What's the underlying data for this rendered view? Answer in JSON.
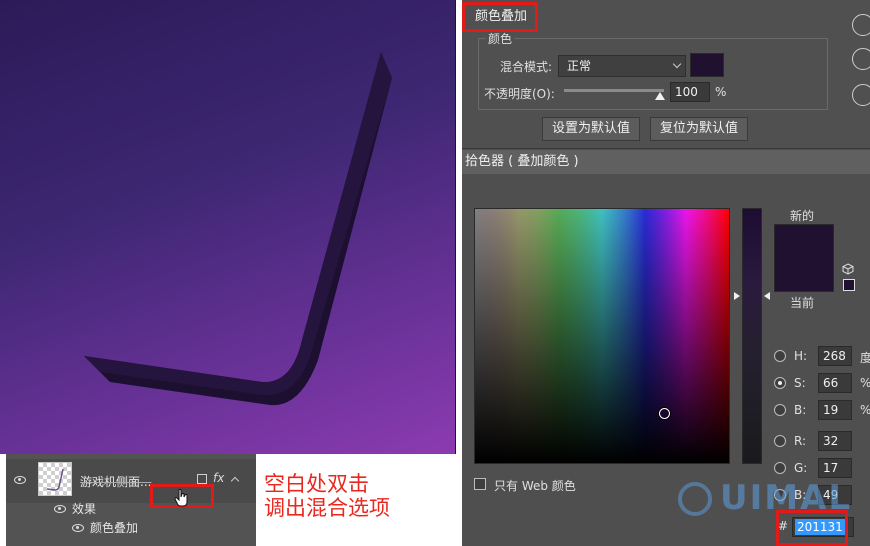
{
  "layers": {
    "layer_name": "游戏机侧面...",
    "effects_label": "效果",
    "effect_item": "颜色叠加",
    "fx_label": "fx"
  },
  "annotation": {
    "line1": "空白处双击",
    "line2": "调出混合选项"
  },
  "layer_style": {
    "title": "颜色叠加",
    "group_label": "颜色",
    "blend_mode_label": "混合模式:",
    "blend_mode_value": "正常",
    "opacity_label": "不透明度(O):",
    "opacity_value": "100",
    "opacity_unit": "%",
    "opacity_level": 1.0,
    "overlay_color": "#201131",
    "set_default_label": "设置为默认值",
    "reset_default_label": "复位为默认值"
  },
  "color_picker": {
    "title": "拾色器 ( 叠加颜色 )",
    "new_label": "新的",
    "current_label": "当前",
    "new_color": "#201131",
    "current_color": "#201131",
    "web_only_label": "只有 Web 颜色",
    "fields": [
      {
        "key": "H:",
        "value": "268",
        "unit": "度",
        "selected": false
      },
      {
        "key": "S:",
        "value": "66",
        "unit": "%",
        "selected": true
      },
      {
        "key": "B:",
        "value": "19",
        "unit": "%",
        "selected": false
      },
      {
        "key": "R:",
        "value": "32",
        "unit": "",
        "selected": false
      },
      {
        "key": "G:",
        "value": "17",
        "unit": "",
        "selected": false
      },
      {
        "key": "B:",
        "value": "49",
        "unit": "",
        "selected": false
      }
    ],
    "hex_label": "#",
    "hex_value": "201131"
  },
  "watermark": "UIMAL",
  "colors": {
    "highlight_red": "#e21a1a",
    "shape_fill": "#22123a",
    "selection_blue": "#3399ff"
  }
}
